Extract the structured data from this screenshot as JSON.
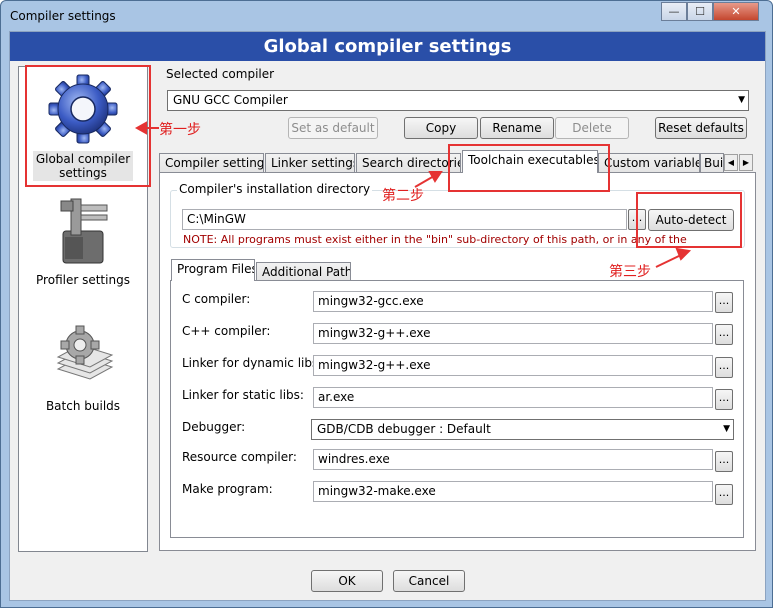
{
  "window": {
    "title": "Compiler settings",
    "minimize_glyph": "—",
    "maximize_glyph": "☐",
    "close_glyph": "✕"
  },
  "header": {
    "title": "Global compiler settings"
  },
  "sidebar": {
    "items": [
      {
        "label_line1": "Global compiler",
        "label_line2": "settings",
        "icon": "gear-icon",
        "selected": true
      },
      {
        "label": "Profiler settings",
        "icon": "profiler-icon"
      },
      {
        "label": "Batch builds",
        "icon": "batch-builds-icon"
      }
    ]
  },
  "selected_compiler": {
    "label": "Selected compiler",
    "value": "GNU GCC Compiler"
  },
  "compiler_buttons": {
    "set_default": "Set as default",
    "copy": "Copy",
    "rename": "Rename",
    "delete": "Delete",
    "reset_defaults": "Reset defaults"
  },
  "tabs": [
    {
      "label": "Compiler settings"
    },
    {
      "label": "Linker settings"
    },
    {
      "label": "Search directories"
    },
    {
      "label": "Toolchain executables",
      "active": true
    },
    {
      "label": "Custom variables"
    },
    {
      "label": "Bui"
    }
  ],
  "toolchain": {
    "install_dir_label": "Compiler's installation directory",
    "install_dir_value": "C:\\MinGW",
    "browse_label": "...",
    "auto_detect": "Auto-detect",
    "note": "NOTE: All programs must exist either in the \"bin\" sub-directory of this path, or in any of the"
  },
  "sub_tabs": [
    {
      "label": "Program Files",
      "active": true
    },
    {
      "label": "Additional Paths"
    }
  ],
  "programs": [
    {
      "label": "C compiler:",
      "value": "mingw32-gcc.exe"
    },
    {
      "label": "C++ compiler:",
      "value": "mingw32-g++.exe"
    },
    {
      "label": "Linker for dynamic libs:",
      "value": "mingw32-g++.exe"
    },
    {
      "label": "Linker for static libs:",
      "value": "ar.exe"
    },
    {
      "label": "Debugger:",
      "value": "GDB/CDB debugger : Default",
      "type": "select"
    },
    {
      "label": "Resource compiler:",
      "value": "windres.exe"
    },
    {
      "label": "Make program:",
      "value": "mingw32-make.exe"
    }
  ],
  "footer": {
    "ok": "OK",
    "cancel": "Cancel"
  },
  "annotations": {
    "step1": "第一步",
    "step2": "第二步",
    "step3": "第三步",
    "color": "#e53333"
  }
}
